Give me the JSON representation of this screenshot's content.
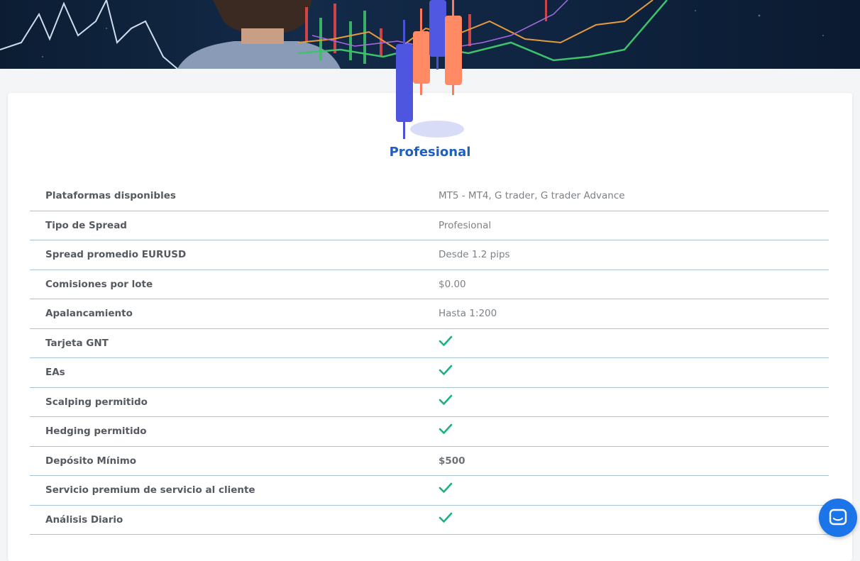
{
  "plan": {
    "title": "Profesional"
  },
  "colors": {
    "accent": "#1f5fbf",
    "check": "#19b37a",
    "chat_button": "#1b74e8"
  },
  "rows": [
    {
      "label": "Plataformas disponibles",
      "value": "MT5 - MT4, G trader, G trader Advance",
      "type": "text"
    },
    {
      "label": "Tipo de Spread",
      "value": "Profesional",
      "type": "text"
    },
    {
      "label": "Spread promedio EURUSD",
      "value": "Desde 1.2 pips",
      "type": "text"
    },
    {
      "label": "Comisiones por lote",
      "value": "$0.00",
      "type": "text"
    },
    {
      "label": "Apalancamiento",
      "value": "Hasta 1:200",
      "type": "text"
    },
    {
      "label": "Tarjeta GNT",
      "value": "",
      "type": "check"
    },
    {
      "label": "EAs",
      "value": "",
      "type": "check"
    },
    {
      "label": "Scalping permitido",
      "value": "",
      "type": "check"
    },
    {
      "label": "Hedging permitido",
      "value": "",
      "type": "check"
    },
    {
      "label": "Depósito Mínimo",
      "value": "$500",
      "type": "bold"
    },
    {
      "label": "Servicio premium de servicio al cliente",
      "value": "",
      "type": "check"
    },
    {
      "label": "Análisis Diario",
      "value": "",
      "type": "check"
    }
  ],
  "icons": {
    "row_check": "check-icon",
    "chat": "chat-icon",
    "plan": "candlestick-icon"
  }
}
